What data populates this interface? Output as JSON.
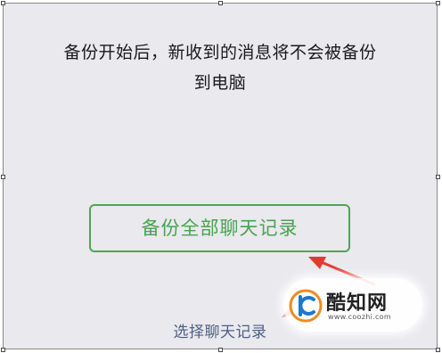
{
  "notice": {
    "line1": "备份开始后，新收到的消息将不会被备份",
    "line2": "到电脑"
  },
  "primary_button": {
    "label": "备份全部聊天记录"
  },
  "select_link": {
    "label": "选择聊天记录"
  },
  "watermark": {
    "name": "酷知网",
    "url": "www.coozhi.com"
  },
  "colors": {
    "background": "#e9e9ee",
    "button_green": "#47a450",
    "link_blue": "#4f5f85",
    "arrow_red": "#e23a2e"
  },
  "icons": {
    "annotation_arrow": "red-arrow-icon",
    "watermark_logo": "coozhi-logo-icon"
  }
}
